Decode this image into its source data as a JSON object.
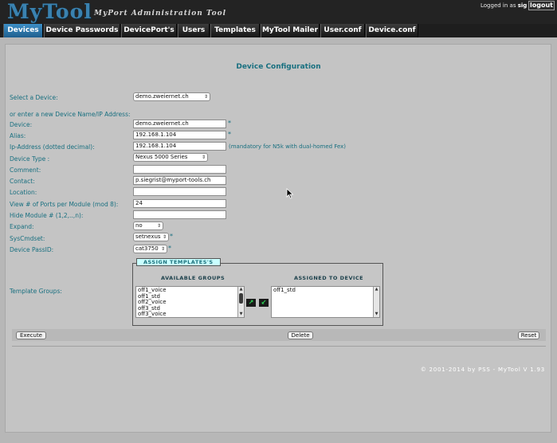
{
  "app": {
    "logo": "MyTool",
    "tagline": "MyPort Administration Tool",
    "login_prefix": "Logged in as",
    "login_user": "sig",
    "logout_label": "logout"
  },
  "nav": {
    "tabs": [
      {
        "label": "Devices",
        "active": true
      },
      {
        "label": "Device Passwords"
      },
      {
        "label": "DevicePort's"
      },
      {
        "label": "Users"
      },
      {
        "label": "Templates"
      },
      {
        "label": "MyTool Mailer"
      },
      {
        "label": "User.conf"
      },
      {
        "label": "Device.conf"
      }
    ]
  },
  "form": {
    "title": "Device Configuration",
    "select_label": "Select a Device:",
    "select_value": "demo.zweiernet.ch",
    "new_label": "or enter a new Device Name/IP Address:",
    "fields": {
      "device": {
        "label": "Device:",
        "value": "demo.zweiernet.ch",
        "required": "*"
      },
      "alias": {
        "label": "Alias:",
        "value": "192.168.1.104",
        "required": "*"
      },
      "ip": {
        "label": "Ip-Address (dotted decimal):",
        "value": "192.168.1.104",
        "note": "(mandatory for N5k with dual-homed Fex)"
      },
      "device_type": {
        "label": "Device Type :",
        "value": "Nexus 5000 Series"
      },
      "comment": {
        "label": "Comment:",
        "value": ""
      },
      "contact": {
        "label": "Contact:",
        "value": "p.siegrist@myport-tools.ch"
      },
      "location": {
        "label": "Location:",
        "value": ""
      },
      "ports": {
        "label": "View # of Ports per Module (mod 8):",
        "value": "24"
      },
      "hide": {
        "label": "Hide Module # (1,2,..,n):",
        "value": ""
      },
      "expand": {
        "label": "Expand:",
        "value": "no"
      },
      "syscmdset": {
        "label": "SysCmdset:",
        "value": "setnexus",
        "required": "*"
      },
      "passid": {
        "label": "Device PassID:",
        "value": "cat3750",
        "required": "*"
      }
    },
    "templates": {
      "label": "Template Groups:",
      "legend": "ASSIGN TEMPLATES'S",
      "available_header": "AVAILABLE GROUPS",
      "assigned_header": "ASSIGNED TO DEVICE",
      "available": [
        "off1_voice",
        "off1_std",
        "off2_voice",
        "off3_std",
        "off3_voice"
      ],
      "assigned": [
        "off1_std"
      ]
    },
    "buttons": {
      "execute": "Execute",
      "delete": "Delete",
      "reset": "Reset"
    }
  },
  "footer": {
    "copyright": "© 2001-2014 by PSS - MyTool V 1.93"
  }
}
